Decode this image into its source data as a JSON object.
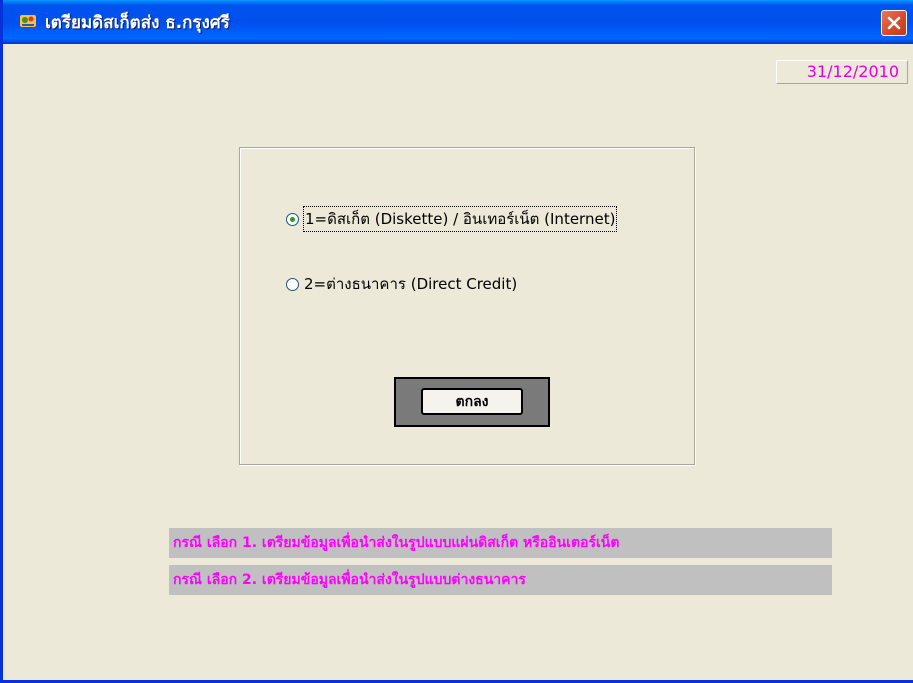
{
  "window": {
    "title": "เตรียมดิสเก็ตส่ง ธ.กรุงศรี",
    "title_icon": "app-icon",
    "close_icon": "close-icon"
  },
  "date": "31/12/2010",
  "options": {
    "selected": 1,
    "items": [
      {
        "label": "1=ดิสเก็ต (Diskette) / อินเทอร์เน็ต (Internet)",
        "checked": true
      },
      {
        "label": "2=ต่างธนาคาร (Direct Credit)",
        "checked": false
      }
    ]
  },
  "ok_button": {
    "label": "ตกลง"
  },
  "info": [
    "กรณี เลือก 1. เตรียมข้อมูลเพื่อนำส่งในรูปแบบแผ่นดิสเก็ต หรืออินเตอร์เน็ต",
    "กรณี เลือก 2. เตรียมข้อมูลเพื่อนำส่งในรูปแบบต่างธนาคาร"
  ],
  "colors": {
    "titlebar": "#0054e3",
    "window_bg": "#ece9d8",
    "date_text": "#e000e0",
    "info_text": "#ff00ff",
    "info_bg": "#c0c0c0"
  }
}
